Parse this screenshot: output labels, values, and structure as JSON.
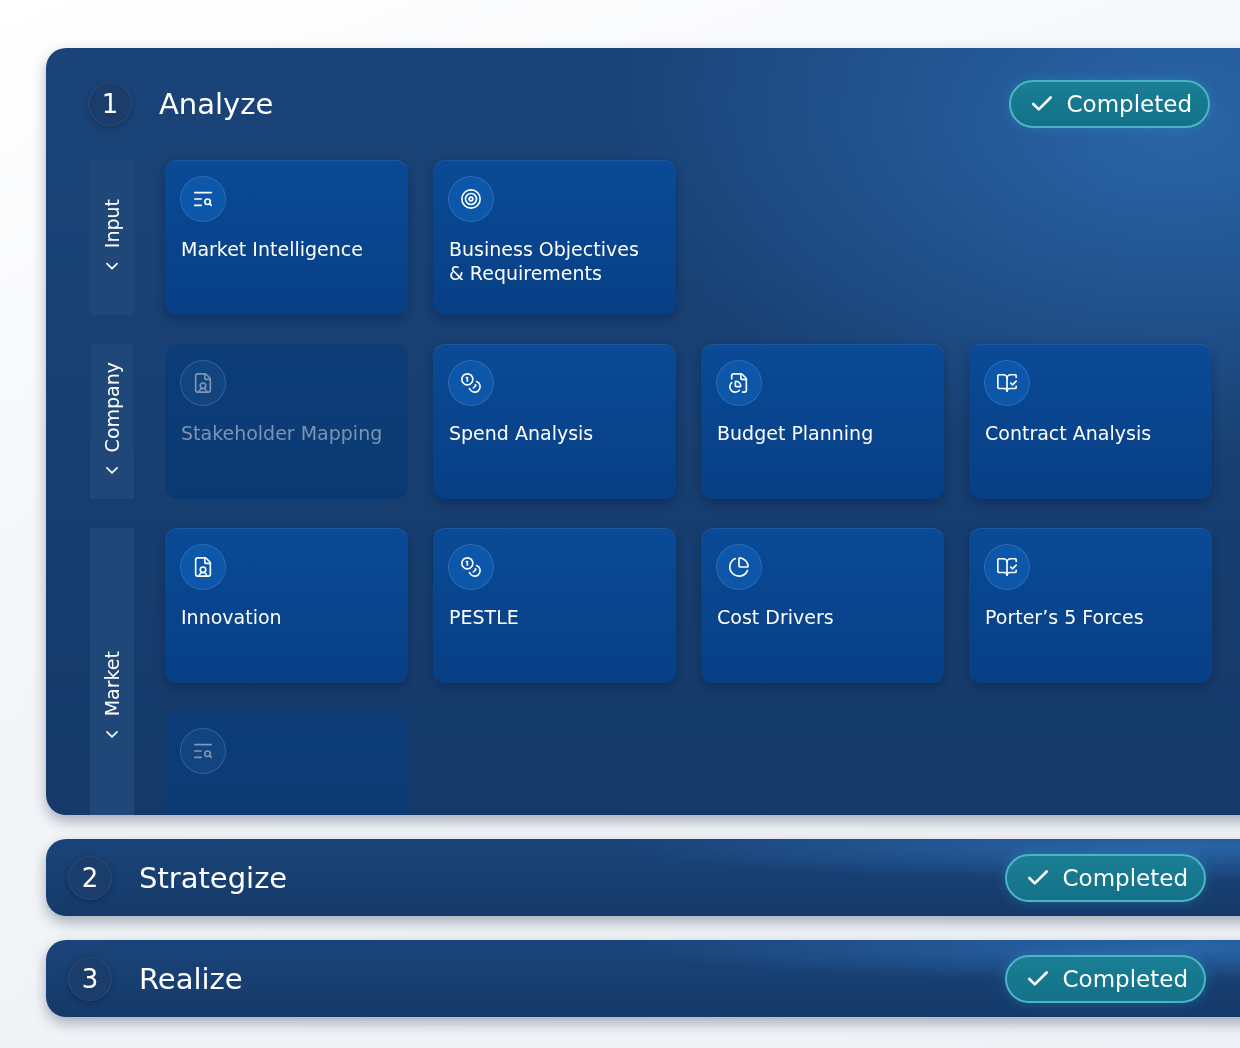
{
  "stages": [
    {
      "number": "1",
      "title": "Analyze",
      "expanded": true,
      "status": "Completed",
      "groups": [
        {
          "label": "Input",
          "cards": [
            {
              "label": "Market Intelligence",
              "disabled": false
            },
            {
              "label": "Business Objectives\n& Requirements",
              "disabled": false
            }
          ]
        },
        {
          "label": "Company",
          "cards": [
            {
              "label": "Stakeholder Mapping",
              "disabled": true
            },
            {
              "label": "Spend Analysis",
              "disabled": false
            },
            {
              "label": "Budget Planning",
              "disabled": false
            },
            {
              "label": "Contract Analysis",
              "disabled": false
            }
          ]
        },
        {
          "label": "Market",
          "cards": [
            {
              "label": "Innovation",
              "disabled": false
            },
            {
              "label": "PESTLE",
              "disabled": false
            },
            {
              "label": "Cost Drivers",
              "disabled": false
            },
            {
              "label": "Porter’s 5 Forces",
              "disabled": false
            },
            {
              "disabled": true
            }
          ]
        }
      ]
    },
    {
      "number": "2",
      "title": "Strategize",
      "expanded": false,
      "status": "Completed"
    },
    {
      "number": "3",
      "title": "Realize",
      "expanded": false,
      "status": "Completed"
    }
  ]
}
